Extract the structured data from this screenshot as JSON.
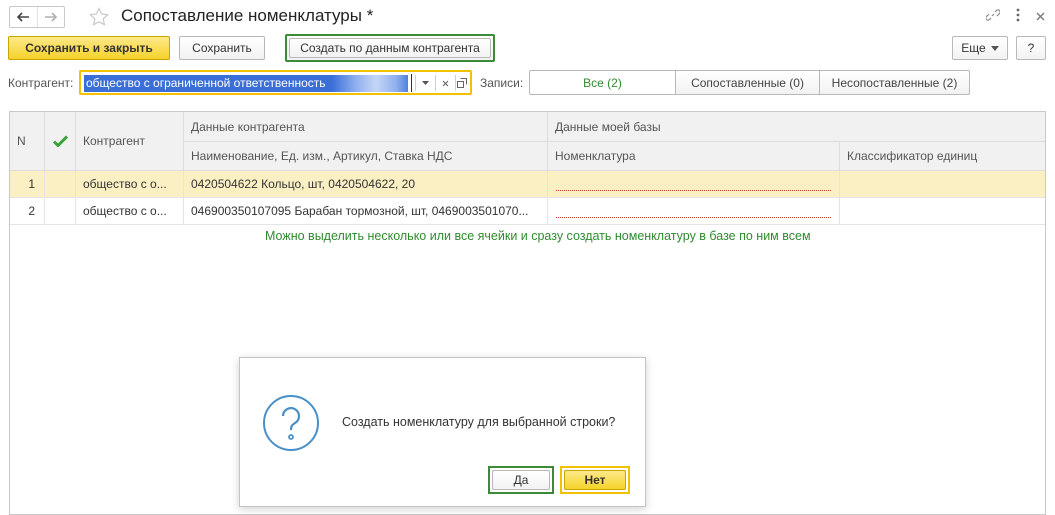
{
  "window": {
    "title": "Сопоставление номенклатуры *",
    "link_icon": "link-icon",
    "more_icon": "more-vertical-icon",
    "close_icon": "close-icon"
  },
  "toolbar": {
    "save_close_label": "Сохранить и закрыть",
    "save_label": "Сохранить",
    "create_by_counterparty_label": "Создать по данным контрагента",
    "more_label": "Еще",
    "help_label": "?"
  },
  "filter": {
    "counterparty_label": "Контрагент:",
    "counterparty_value": "общество с ограниченной ответственность",
    "records_label": "Записи:",
    "segments": [
      {
        "label": "Все (2)",
        "active": true
      },
      {
        "label": "Сопоставленные (0)",
        "active": false
      },
      {
        "label": "Несопоставленные (2)",
        "active": false
      }
    ]
  },
  "table": {
    "headers": {
      "n": "N",
      "check_icon": "checkmark-icon",
      "counterparty": "Контрагент",
      "counterparty_data": "Данные контрагента",
      "my_base_data": "Данные моей базы",
      "name_unit_article_vat": "Наименование, Ед. изм., Артикул, Ставка НДС",
      "nomenclature": "Номенклатура",
      "unit_classifier": "Классификатор единиц"
    },
    "rows": [
      {
        "n": "1",
        "counterparty": "общество с о...",
        "data": "0420504622 Кольцо, шт, 0420504622, 20",
        "nomenclature": "",
        "unit": "",
        "selected": true
      },
      {
        "n": "2",
        "counterparty": "общество с о...",
        "data": "046900350107095 Барабан тормозной, шт, 0469003501070...",
        "nomenclature": "",
        "unit": "",
        "selected": false
      }
    ],
    "hint": "Можно выделить несколько или все ячейки и сразу создать номенклатуру в базе по ним всем"
  },
  "dialog": {
    "icon": "question-icon",
    "message": "Создать номенклатуру для выбранной строки?",
    "yes_label": "Да",
    "no_label": "Нет"
  },
  "colors": {
    "accent_yellow": "#f5d32a",
    "highlight_green": "#3f8a3a",
    "hint_green": "#2e8b2e",
    "selected_row": "#fbf0c4",
    "selection_blue": "#3b6fd8",
    "question_blue": "#4a90c8"
  }
}
